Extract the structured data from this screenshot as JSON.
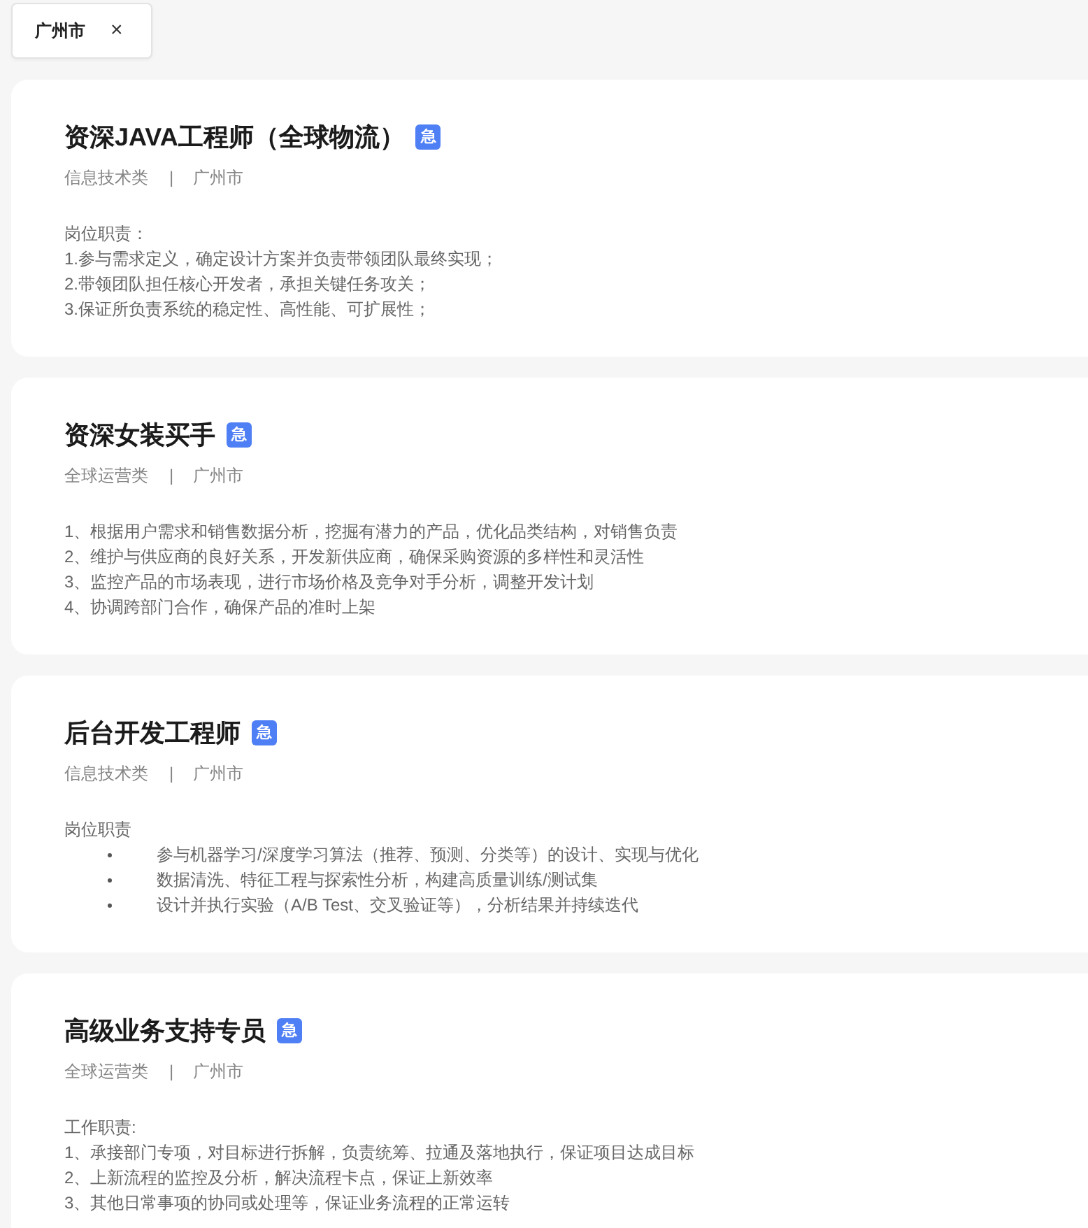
{
  "filter_chip": {
    "label": "广州市",
    "close": "×"
  },
  "jobs": [
    {
      "title": "资深JAVA工程师（全球物流）",
      "badge": "急",
      "category": "信息技术类",
      "separator": "|",
      "city": "广州市",
      "duties": {
        "heading": "岗位职责：",
        "bulleted": false,
        "items": [
          "1.参与需求定义，确定设计方案并负责带领团队最终实现；",
          "2.带领团队担任核心开发者，承担关键任务攻关；",
          "3.保证所负责系统的稳定性、高性能、可扩展性；"
        ]
      }
    },
    {
      "title": "资深女装买手",
      "badge": "急",
      "category": "全球运营类",
      "separator": "|",
      "city": "广州市",
      "duties": {
        "bulleted": false,
        "items": [
          "1、根据用户需求和销售数据分析，挖掘有潜力的产品，优化品类结构，对销售负责",
          "2、维护与供应商的良好关系，开发新供应商，确保采购资源的多样性和灵活性",
          "3、监控产品的市场表现，进行市场价格及竞争对手分析，调整开发计划",
          "4、协调跨部门合作，确保产品的准时上架"
        ]
      }
    },
    {
      "title": "后台开发工程师",
      "badge": "急",
      "category": "信息技术类",
      "separator": "|",
      "city": "广州市",
      "duties": {
        "heading": "岗位职责",
        "bulleted": true,
        "items": [
          "参与机器学习/深度学习算法（推荐、预测、分类等）的设计、实现与优化",
          "数据清洗、特征工程与探索性分析，构建高质量训练/测试集",
          "设计并执行实验（A/B Test、交叉验证等），分析结果并持续迭代"
        ]
      }
    },
    {
      "title": "高级业务支持专员",
      "badge": "急",
      "category": "全球运营类",
      "separator": "|",
      "city": "广州市",
      "duties": {
        "heading": "工作职责:",
        "bulleted": false,
        "items": [
          "1、承接部门专项，对目标进行拆解，负责统筹、拉通及落地执行，保证项目达成目标",
          "2、上新流程的监控及分析，解决流程卡点，保证上新效率",
          "3、其他日常事项的协同或处理等，保证业务流程的正常运转"
        ]
      }
    }
  ]
}
